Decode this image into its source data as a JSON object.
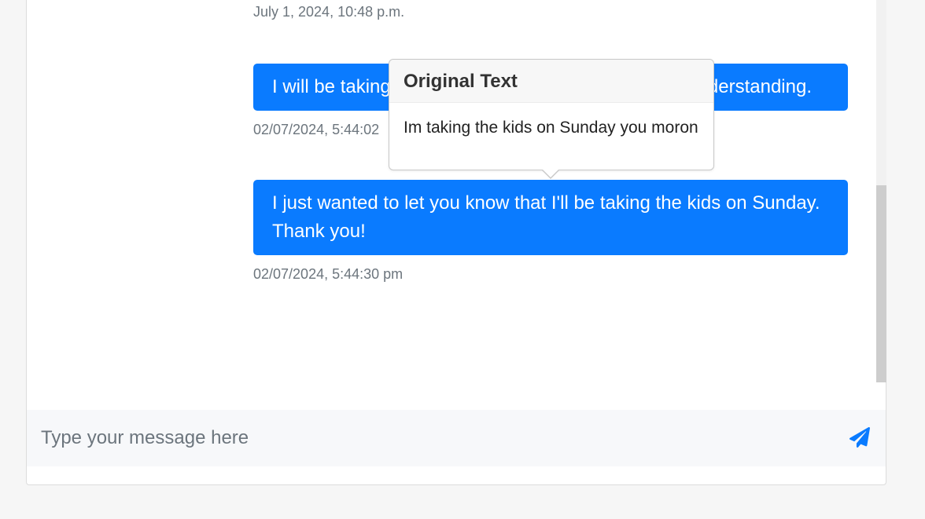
{
  "messages": [
    {
      "timestamp": "July 1, 2024, 10:48 p.m."
    },
    {
      "text_left": "I will be taking",
      "text_right": "derstanding.",
      "timestamp": "02/07/2024, 5:44:02"
    },
    {
      "text": "I just wanted to let you know that I'll be taking the kids on Sunday. Thank you!",
      "timestamp": "02/07/2024, 5:44:30 pm"
    }
  ],
  "popover": {
    "title": "Original Text",
    "body": "Im taking the kids on Sunday you moron"
  },
  "composer": {
    "placeholder": "Type your message here",
    "send_icon": "paper-plane-icon"
  },
  "colors": {
    "bubble": "#0a7bff",
    "accent": "#0a7bff",
    "timestamp": "#6c757d"
  }
}
